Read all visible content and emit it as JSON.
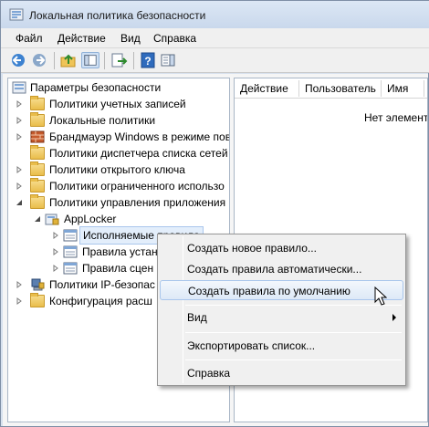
{
  "window": {
    "title": "Локальная политика безопасности",
    "icon": "security-policy-icon"
  },
  "menu": [
    "Файл",
    "Действие",
    "Вид",
    "Справка"
  ],
  "toolbar": {
    "buttons": [
      "back-arrow-icon",
      "forward-arrow-icon",
      "up-folder-icon",
      "show-hide-tree-icon",
      "export-list-icon",
      "help-icon",
      "properties-pane-icon"
    ]
  },
  "tree": {
    "root": "Параметры безопасности",
    "items": [
      "Политики учетных записей",
      "Локальные политики",
      "Брандмауэр Windows в режиме пов",
      "Политики диспетчера списка сетей",
      "Политики открытого ключа",
      "Политики ограниченного использо",
      "Политики управления приложения",
      "AppLocker",
      "Исполняемые правила",
      "Правила устан",
      "Правила сцен",
      "Политики IP-безопас",
      "Конфигурация расш"
    ]
  },
  "right_pane": {
    "columns": [
      "Действие",
      "Пользователь",
      "Имя"
    ],
    "empty_text": "Нет элементо"
  },
  "context_menu": {
    "items": [
      "Создать новое правило...",
      "Создать правила автоматически...",
      "Создать правила по умолчанию",
      "Вид",
      "Экспортировать список...",
      "Справка"
    ]
  }
}
